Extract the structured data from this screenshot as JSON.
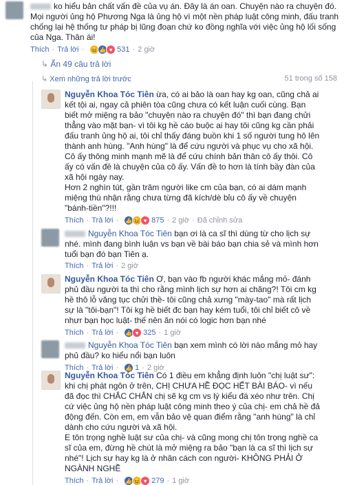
{
  "top_comment": {
    "text": "ko hiểu bản chất vấn đề của vụ án. Đây là án oan. Chuyện nào ra chuyện đó. Mọi người ủng hộ Phương Nga là ủng hộ vì một nền pháp luật công minh, đấu tranh chống lại hệ thống tư pháp bị lũng đoạn chứ ko đồng nghĩa với việc ủng hộ lối sống của Nga. Thân ái!",
    "like_label": "Thích",
    "reply_label": "Trả lời",
    "reaction_count": "531",
    "time": "2 giờ"
  },
  "hide_replies": "Ẩn 49 câu trả lời",
  "view_previous": "Xem những trả lời trước",
  "pagination": "51 trong số 158",
  "replies": [
    {
      "name": "Nguyễn Khoa Tóc Tiên",
      "text": "ừa, có ai bảo là oan hay kg oan, cũng chả ai kết tội ai, ngay cả phiên tòa cũng chưa có kết luận cuối cùng. Bạn biết mở miệng ra bảo \"chuyện nào ra chuyện đó\" thì bạn đang chửi thẳng vào mặt bạn- vì tôi kg hề cáo buộc ai hay tôi cũng kg cần phải đấu tranh ủng hộ ai, tôi chỉ thấy đáng buồn khi 1 số người tung hô lên thành anh hùng. \"Anh hùng\" là để cứu người và phục vụ cho xã hội. Cô ấy thông minh mạnh mẽ là để cứu chính bản thân cô ấy thôi. Cô ấy có vấn đề là chuyện của cô ấy. Vấn đề to hơn là tính bầy đàn của xã hội ngày nay.",
      "text2": "Hơn 2 nghìn tút, gần trăm người like cm của bạn, có ai dám mạnh miệng thú nhận rằng chưa từng đã kích/dè bỉu cô ấy về chuyện \"bánh-tiền\"?!!!",
      "like_label": "Thích",
      "reply_label": "Trả lời",
      "reaction_count": "875",
      "time": "2 giờ",
      "edited": "Đã chỉnh sửa"
    },
    {
      "name": "Nguyễn Khoa Tóc Tiên",
      "text": "bạn ơi là ca sĩ thì dùng từ cho lịch sự nhé. mình đang bình luận vs bạn về bài báo bạn chia sẻ và mình hơn tuổi bạn đó bạn Tiên ạ.",
      "like_label": "Thích",
      "reply_label": "Trả lời",
      "reaction_count": "",
      "time": "2 giờ"
    },
    {
      "name": "Nguyễn Khoa Tóc Tiên",
      "text": "Ơ, bạn vào fb người khác mắng mỏ- đánh phủ đầu người ta thì cho rằng mình lịch sự hơn ai chăng?! Tôi cm kg hề thô lỗ văng tục chửi thề- tôi cũng chả xưng \"mày-tao\" mà rất lịch sự là \"tôi-bạn\"! Tôi kg hề biết đc bạn hay kém tuổi, tôi chỉ biết cô về nhưr bạn học luật- thế nên ăn nói có logic hơn bạn nhé",
      "like_label": "Thích",
      "reply_label": "Trả lời",
      "reaction_count": "325",
      "time": "1 giờ"
    },
    {
      "name": "Nguyễn Khoa Tóc Tiên",
      "text": "bạn xem mình có lời nào mắng mỏ hay phủ đầu? ko hiểu nổi bạn luôn",
      "like_label": "Thích",
      "reply_label": "Trả lời",
      "reaction_count": "1",
      "time": "2 giờ"
    },
    {
      "name": "Nguyễn Khoa Tóc Tiên",
      "text": "Có 1 điều em khẳng định luôn \"chị luật sư\": khi chị phát ngôn ở trên, CHỊ CHƯA HỀ ĐỌC HẾT BÀI BÁO- vì nếu đã đọc thì CHẮC CHẮN chị sẽ kg cm vs lý kiểu đá xéo như trên. Chị cứ việc ủng hộ nền pháp luật công minh theo ý của chị- em chả hề đả động đến. Còn em, em vẫn bảo vệ quan điểm rằng \"anh hùng\" là chỉ dành cho cứu người và xã hội.",
      "text2": "E tôn trọng nghề luật sư của chị- và cũng mong chị tôn trọng nghề ca sĩ của em, đừng hề chút là mở miệng ra bảo \"bạn là ca sĩ thì lịch sự nhé\"! Lịch sự hay kg là ở nhân cách con người- KHÔNG PHẢI Ở NGÀNH NGHỀ",
      "like_label": "Thích",
      "reply_label": "Trả lời",
      "reaction_count": "279",
      "time": "1 giờ"
    }
  ]
}
